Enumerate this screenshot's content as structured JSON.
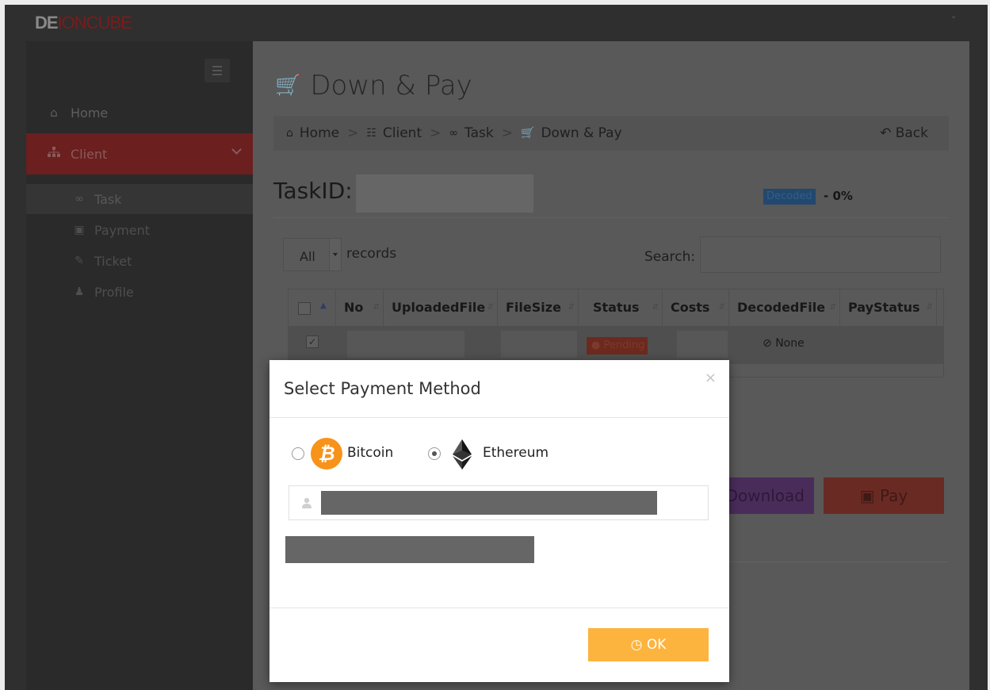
{
  "logo": {
    "part1": "DE",
    "part2": "IONCUBE"
  },
  "sidebar": {
    "items": [
      {
        "label": "Home",
        "icon": "home-icon"
      },
      {
        "label": "Client",
        "icon": "sitemap-icon"
      }
    ],
    "subitems": [
      {
        "label": "Task",
        "icon": "link-icon"
      },
      {
        "label": "Payment",
        "icon": "money-icon"
      },
      {
        "label": "Ticket",
        "icon": "edit-icon"
      },
      {
        "label": "Profile",
        "icon": "user-icon"
      }
    ]
  },
  "page": {
    "title": "Down & Pay"
  },
  "breadcrumb": {
    "items": [
      "Home",
      "Client",
      "Task",
      "Down & Pay"
    ],
    "back": "Back"
  },
  "task": {
    "label": "TaskID:",
    "status_badge": "Decoded",
    "percent": "- 0%"
  },
  "table_controls": {
    "length_value": "All",
    "records_label": "records",
    "search_label": "Search:"
  },
  "table": {
    "columns": [
      "No",
      "UploadedFile",
      "FileSize",
      "Status",
      "Costs",
      "DecodedFile",
      "PayStatus"
    ],
    "rows": [
      {
        "status": "Pending",
        "decoded": "None"
      }
    ]
  },
  "buttons": {
    "download": "Download",
    "pay": "Pay"
  },
  "modal": {
    "title": "Select Payment Method",
    "options": [
      {
        "label": "Bitcoin",
        "selected": false
      },
      {
        "label": "Ethereum",
        "selected": true
      }
    ],
    "ok": "OK"
  },
  "colors": {
    "accent": "#fdb43e",
    "bitcoin": "#f7931a",
    "danger": "#c0392b"
  }
}
